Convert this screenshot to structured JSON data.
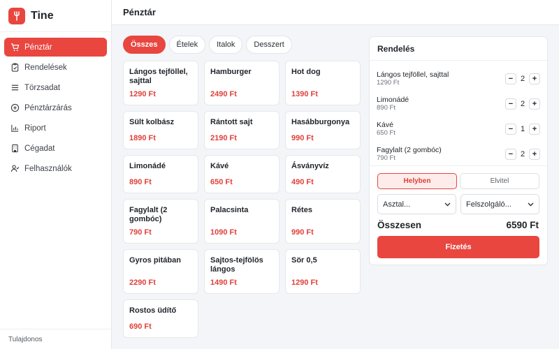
{
  "app": {
    "name": "Tine"
  },
  "colors": {
    "accent": "#e8463f",
    "price": "#e0403a"
  },
  "sidebar": {
    "items": [
      {
        "label": "Pénztár",
        "icon": "cart-icon",
        "active": true
      },
      {
        "label": "Rendelések",
        "icon": "clipboard-icon"
      },
      {
        "label": "Törzsadat",
        "icon": "list-icon"
      },
      {
        "label": "Pénztárzárás",
        "icon": "circle-plus-icon"
      },
      {
        "label": "Riport",
        "icon": "bar-chart-icon"
      },
      {
        "label": "Cégadat",
        "icon": "building-icon"
      },
      {
        "label": "Felhasználók",
        "icon": "user-check-icon"
      }
    ],
    "footer": "Tulajdonos"
  },
  "header": {
    "title": "Pénztár"
  },
  "tabs": [
    {
      "label": "Összes",
      "active": true
    },
    {
      "label": "Ételek"
    },
    {
      "label": "Italok"
    },
    {
      "label": "Desszert"
    }
  ],
  "products": [
    {
      "name": "Lángos tejföllel, sajttal",
      "price": "1290 Ft"
    },
    {
      "name": "Hamburger",
      "price": "2490 Ft"
    },
    {
      "name": "Hot dog",
      "price": "1390 Ft"
    },
    {
      "name": "Sült kolbász",
      "price": "1890 Ft"
    },
    {
      "name": "Rántott sajt",
      "price": "2190 Ft"
    },
    {
      "name": "Hasábburgonya",
      "price": "990 Ft"
    },
    {
      "name": "Limonádé",
      "price": "890 Ft"
    },
    {
      "name": "Kávé",
      "price": "650 Ft"
    },
    {
      "name": "Ásványvíz",
      "price": "490 Ft"
    },
    {
      "name": "Fagylalt (2 gombóc)",
      "price": "790 Ft"
    },
    {
      "name": "Palacsinta",
      "price": "1090 Ft"
    },
    {
      "name": "Rétes",
      "price": "990 Ft"
    },
    {
      "name": "Gyros pitában",
      "price": "2290 Ft"
    },
    {
      "name": "Sajtos-tejfölös lángos",
      "price": "1490 Ft"
    },
    {
      "name": "Sör 0,5",
      "price": "1290 Ft"
    },
    {
      "name": "Rostos üdítő",
      "price": "690 Ft"
    }
  ],
  "order": {
    "title": "Rendelés",
    "lines": [
      {
        "name": "Lángos tejföllel, sajttal",
        "price": "1290 Ft",
        "qty": "2"
      },
      {
        "name": "Limonádé",
        "price": "890 Ft",
        "qty": "2"
      },
      {
        "name": "Kávé",
        "price": "650 Ft",
        "qty": "1"
      },
      {
        "name": "Fagylalt (2 gombóc)",
        "price": "790 Ft",
        "qty": "2"
      }
    ],
    "minus": "−",
    "plus": "+",
    "mode": {
      "dine_in": "Helyben",
      "takeaway": "Elvitel"
    },
    "table_select": "Asztal...",
    "waiter_select": "Felszolgáló...",
    "total_label": "Összesen",
    "total_value": "6590 Ft",
    "pay_label": "Fizetés"
  }
}
